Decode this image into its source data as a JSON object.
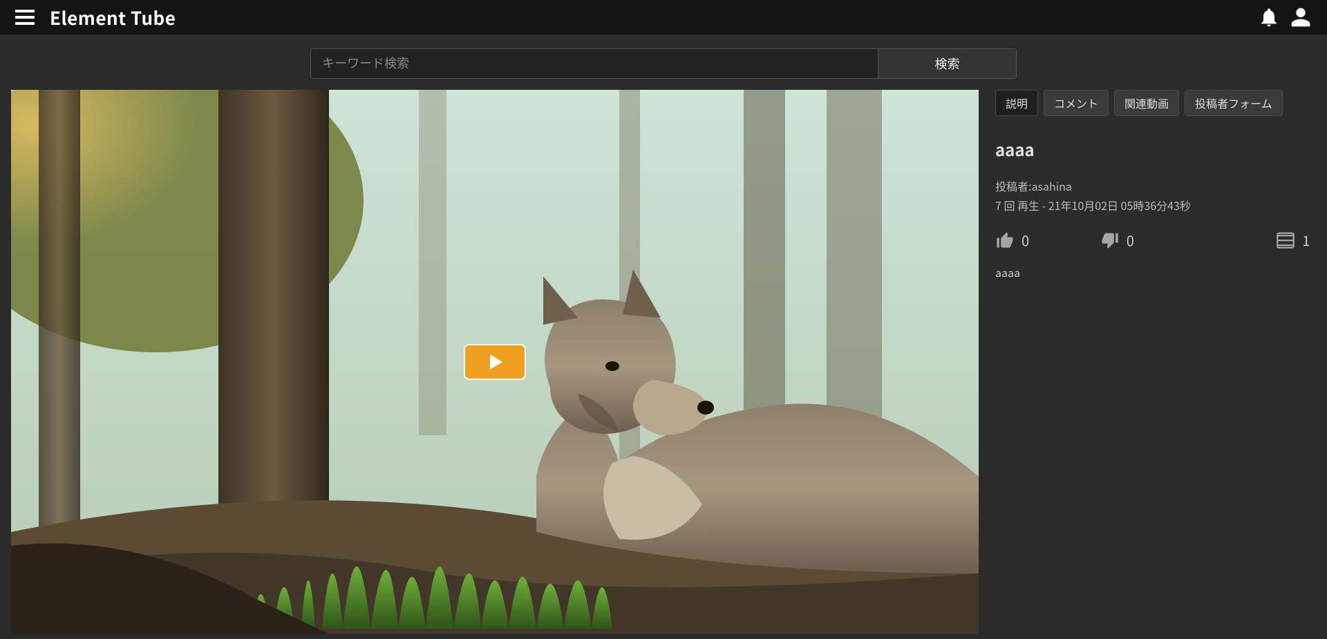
{
  "header": {
    "brand": "Element Tube"
  },
  "search": {
    "placeholder": "キーワード検索",
    "button": "検索"
  },
  "tabs": {
    "t0": "説明",
    "t1": "コメント",
    "t2": "関連動画",
    "t3": "投稿者フォーム"
  },
  "video": {
    "title": "aaaa",
    "uploader": "投稿者:asahina",
    "views": "7 回 再生 - 21年10月02日 05時36分43秒",
    "likes": "0",
    "dislikes": "0",
    "playlist": "1",
    "description": "aaaa"
  }
}
